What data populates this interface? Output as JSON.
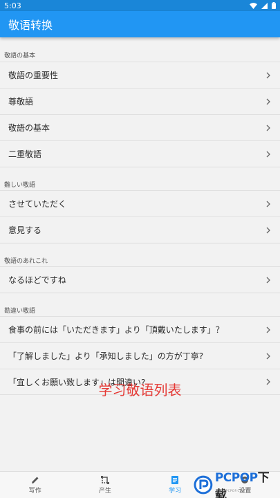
{
  "status_bar": {
    "time": "5:03"
  },
  "app_bar": {
    "title": "敬语转换"
  },
  "sections": [
    {
      "header": "敬語の基本",
      "items": [
        "敬語の重要性",
        "尊敬語",
        "敬語の基本",
        "二重敬語"
      ]
    },
    {
      "header": "難しい敬語",
      "items": [
        "させていただく",
        "意見する"
      ]
    },
    {
      "header": "敬語のあれこれ",
      "items": [
        "なるほどですね"
      ]
    },
    {
      "header": "勘違い敬語",
      "items": [
        "食事の前には「いただきます」より「頂戴いたします」？",
        "「了解しました」より「承知しました」の方が丁寧?",
        "「宜しくお願い致します」は間違い?"
      ]
    }
  ],
  "promo_text": "学习敬语列表",
  "bottom_nav": [
    {
      "label": "写作",
      "icon": "pencil-icon"
    },
    {
      "label": "产生",
      "icon": "transform-icon"
    },
    {
      "label": "学习",
      "icon": "document-icon",
      "active": true
    },
    {
      "label": "设置",
      "icon": "settings-icon"
    }
  ],
  "watermark": {
    "logo_main": "PCPOP",
    "logo_suffix": "下载",
    "sub": "WWW.PCPOP.COM"
  },
  "colors": {
    "primary": "#2196f3",
    "status_bar": "#1a86d8",
    "promo": "#e53935",
    "background": "#f2f2f2"
  }
}
